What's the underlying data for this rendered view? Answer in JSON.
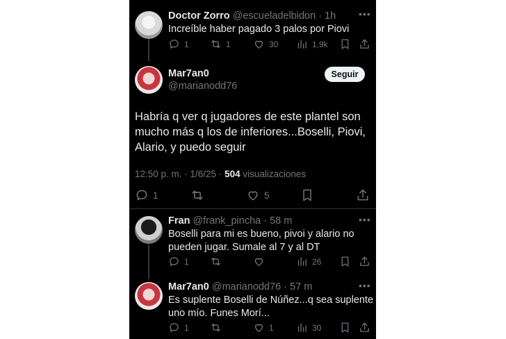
{
  "tweets": {
    "doctor": {
      "name": "Doctor Zorro",
      "handle": "@escueladelbidon",
      "time": "· 1h",
      "text": "Increíble haber pagado 3 palos por Piovi",
      "replies": "1",
      "retweets": "1",
      "likes": "30",
      "views": "1,9k"
    },
    "main": {
      "name": "Mar7an0",
      "handle": "@marianodd76",
      "follow": "Seguir",
      "text_line1": "Habría q ver q jugadores de este plantel son",
      "text_line2": "mucho más q los de inferiores...Boselli, Piovi,",
      "text_line3": "Alario, y puedo seguir",
      "time": "12:50 p. m. · 1/6/25 · ",
      "views_count": "504",
      "views_label": " visualizaciones",
      "replies": "1",
      "likes": "5"
    },
    "fran": {
      "name": "Fran",
      "handle": "@frank_pincha",
      "time": "· 58 m",
      "text_line1": "Boselli para mi es bueno, pivoi y alario no",
      "text_line2": "pueden jugar. Sumale al 7 y al DT",
      "replies": "1",
      "views": "26"
    },
    "reply": {
      "name": "Mar7an0",
      "handle": "@marianodd76",
      "time": "· 57 m",
      "text_line1": "Es suplente Boselli de Núñez...q sea suplente",
      "text_line2": "uno mío. Funes Morí...",
      "replies": "1",
      "likes": "1",
      "views": "30"
    }
  },
  "icons": [
    "reply-icon",
    "retweet-icon",
    "like-icon",
    "views-icon",
    "bookmark-icon",
    "share-icon",
    "more-icon"
  ]
}
